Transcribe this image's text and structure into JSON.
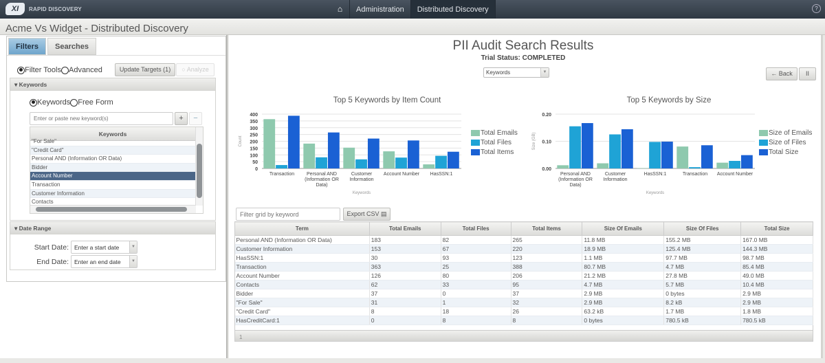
{
  "app": {
    "brand": "RAPID DISCOVERY",
    "logo_text": "XI",
    "nav": {
      "home_icon": "home-icon",
      "tabs": [
        "Administration",
        "Distributed Discovery"
      ],
      "active_tab": "Distributed Discovery"
    },
    "help_icon": "?"
  },
  "page_title": "Acme Vs Widget - Distributed Discovery",
  "left": {
    "tabs": [
      "Filters",
      "Searches"
    ],
    "active_tab": "Filters",
    "mode_radios": [
      {
        "label": "Filter Tools",
        "checked": true
      },
      {
        "label": "Advanced",
        "checked": false
      }
    ],
    "update_targets_label": "Update Targets (1)",
    "analyze_label": "Analyze",
    "keywords_section": {
      "title": "Keywords",
      "radios": [
        {
          "label": "Keywords",
          "checked": true
        },
        {
          "label": "Free Form",
          "checked": false
        }
      ],
      "input_placeholder": "Enter or paste new keyword(s)",
      "add_label": "+",
      "remove_label": "−",
      "list_header": "Keywords",
      "items": [
        "\"For Sale\"",
        "\"Credit Card\"",
        "Personal AND (Information OR Data)",
        "Bidder",
        "Account Number",
        "Transaction",
        "Customer Information",
        "Contacts"
      ],
      "selected": "Account Number"
    },
    "date_section": {
      "title": "Date Range",
      "start_label": "Start Date:",
      "start_placeholder": "Enter a start date",
      "end_label": "End Date:",
      "end_placeholder": "Enter an end date"
    }
  },
  "right": {
    "title": "PII Audit Search Results",
    "status": "Trial Status: COMPLETED",
    "view_select": "Keywords",
    "back_label": "← Back",
    "pause_label": "II",
    "filter_placeholder": "Filter grid by keyword",
    "export_label": "Export CSV",
    "grid": {
      "columns": [
        "Term",
        "Total Emails",
        "Total Files",
        "Total Items",
        "Size Of Emails",
        "Size Of Files",
        "Total Size"
      ],
      "rows": [
        [
          "Personal AND (Information OR Data)",
          "183",
          "82",
          "265",
          "11.8 MB",
          "155.2 MB",
          "167.0 MB"
        ],
        [
          "Customer Information",
          "153",
          "67",
          "220",
          "18.9 MB",
          "125.4 MB",
          "144.3 MB"
        ],
        [
          "HasSSN:1",
          "30",
          "93",
          "123",
          "1.1 MB",
          "97.7 MB",
          "98.7 MB"
        ],
        [
          "Transaction",
          "363",
          "25",
          "388",
          "80.7 MB",
          "4.7 MB",
          "85.4 MB"
        ],
        [
          "Account Number",
          "126",
          "80",
          "206",
          "21.2 MB",
          "27.8 MB",
          "49.0 MB"
        ],
        [
          "Contacts",
          "62",
          "33",
          "95",
          "4.7 MB",
          "5.7 MB",
          "10.4 MB"
        ],
        [
          "Bidder",
          "37",
          "0",
          "37",
          "2.9 MB",
          "0 bytes",
          "2.9 MB"
        ],
        [
          "\"For Sale\"",
          "31",
          "1",
          "32",
          "2.9 MB",
          "8.2 kB",
          "2.9 MB"
        ],
        [
          "\"Credit Card\"",
          "8",
          "18",
          "26",
          "63.2 kB",
          "1.7 MB",
          "1.8 MB"
        ],
        [
          "HasCreditCard:1",
          "0",
          "8",
          "8",
          "0 bytes",
          "780.5 kB",
          "780.5 kB"
        ]
      ],
      "page": "1"
    }
  },
  "chart_data": [
    {
      "type": "bar",
      "title": "Top 5 Keywords by Item Count",
      "xlabel": "Keywords",
      "ylabel": "Count",
      "ylim": [
        0,
        400
      ],
      "yticks": [
        0,
        50,
        100,
        150,
        200,
        250,
        300,
        350,
        400
      ],
      "ytick_labels": [
        "0",
        "50",
        "100",
        "150",
        "200",
        "250",
        "300",
        "350",
        "400"
      ],
      "grid": true,
      "legend_position": "right",
      "categories": [
        [
          "Transaction"
        ],
        [
          "Personal AND",
          "(Information OR",
          "Data)"
        ],
        [
          "Customer",
          "Information"
        ],
        [
          "Account Number"
        ],
        [
          "HasSSN:1"
        ]
      ],
      "series": [
        {
          "name": "Total Emails",
          "color": "#8ec9ae",
          "values": [
            363,
            183,
            153,
            126,
            30
          ]
        },
        {
          "name": "Total Files",
          "color": "#1fa3d6",
          "values": [
            25,
            82,
            67,
            80,
            93
          ]
        },
        {
          "name": "Total Items",
          "color": "#1a61d4",
          "values": [
            388,
            265,
            220,
            206,
            123
          ]
        }
      ]
    },
    {
      "type": "bar",
      "title": "Top 5 Keywords by Size",
      "xlabel": "Keywords",
      "ylabel": "Size (GB)",
      "ylim": [
        0,
        0.2
      ],
      "yticks": [
        0,
        0.1,
        0.2
      ],
      "ytick_labels": [
        "0.00",
        "0.10",
        "0.20"
      ],
      "grid": true,
      "legend_position": "right",
      "categories": [
        [
          "Personal AND",
          "(Information OR",
          "Data)"
        ],
        [
          "Customer",
          "Information"
        ],
        [
          "HasSSN:1"
        ],
        [
          "Transaction"
        ],
        [
          "Account Number"
        ]
      ],
      "series": [
        {
          "name": "Size of Emails",
          "color": "#8ec9ae",
          "values": [
            0.0118,
            0.0189,
            0.0011,
            0.0807,
            0.0212
          ]
        },
        {
          "name": "Size of Files",
          "color": "#1fa3d6",
          "values": [
            0.1552,
            0.1254,
            0.0977,
            0.0047,
            0.0278
          ]
        },
        {
          "name": "Total Size",
          "color": "#1a61d4",
          "values": [
            0.167,
            0.1443,
            0.0987,
            0.0854,
            0.049
          ]
        }
      ]
    }
  ]
}
